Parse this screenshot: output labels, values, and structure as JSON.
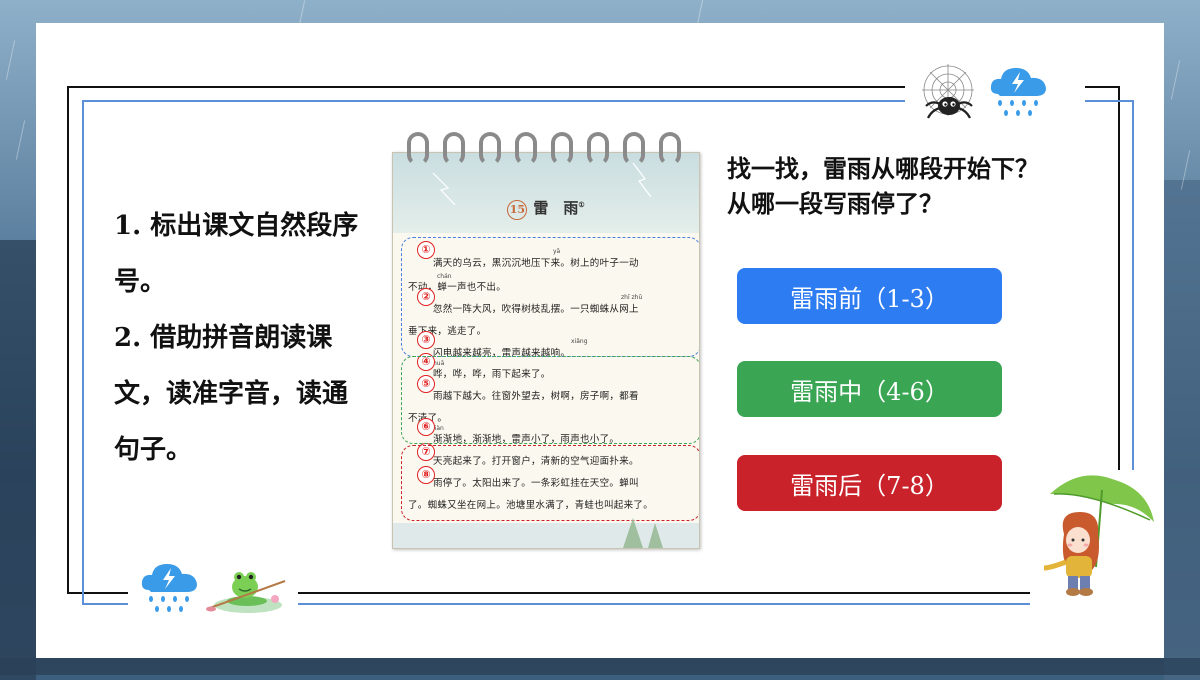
{
  "instructions": {
    "item1": "1. 标出课文自然段序号。",
    "item2": "2. 借助拼音朗读课文，读准字音，读通句子。"
  },
  "question": {
    "line1": "找一找，雷雨从哪段开始下？",
    "line2": "从哪一段写雨停了？"
  },
  "buttons": {
    "before": "雷雨前（1-3）",
    "during": "雷雨中（4-6）",
    "after": "雷雨后（7-8）"
  },
  "colors": {
    "before": "#2e7cf2",
    "during": "#3aa654",
    "after": "#c9222a",
    "frame_blue": "#5b8fd6"
  },
  "notebook": {
    "lesson_number": "15",
    "lesson_title": "雷　雨",
    "footnote_mark": "①",
    "paragraph_markers": [
      "①",
      "②",
      "③",
      "④",
      "⑤",
      "⑥",
      "⑦",
      "⑧"
    ],
    "lines": [
      "满天的乌云，黑沉沉地压下来。树上的叶子一动",
      "不动，蝉一声也不出。",
      "忽然一阵大风，吹得树枝乱摆。一只蜘蛛从网上",
      "垂下来，逃走了。",
      "闪电越来越亮，雷声越来越响。",
      "哗，哗，哗，雨下起来了。",
      "雨越下越大。往窗外望去，树啊，房子啊，都看",
      "不清了。",
      "渐渐地，渐渐地，雷声小了，雨声也小了。",
      "天亮起来了。打开窗户，清新的空气迎面扑来。",
      "雨停了。太阳出来了。一条彩虹挂在天空。蝉叫",
      "了。蜘蛛又坐在网上。池塘里水满了，青蛙也叫起来了。"
    ],
    "pinyin": [
      "yā",
      "chán",
      "zhī zhū",
      "xiǎng",
      "huā",
      "jiàn"
    ]
  },
  "icons": [
    "cloud-lightning-icon",
    "spider-icon",
    "frog-icon",
    "girl-umbrella-icon"
  ]
}
